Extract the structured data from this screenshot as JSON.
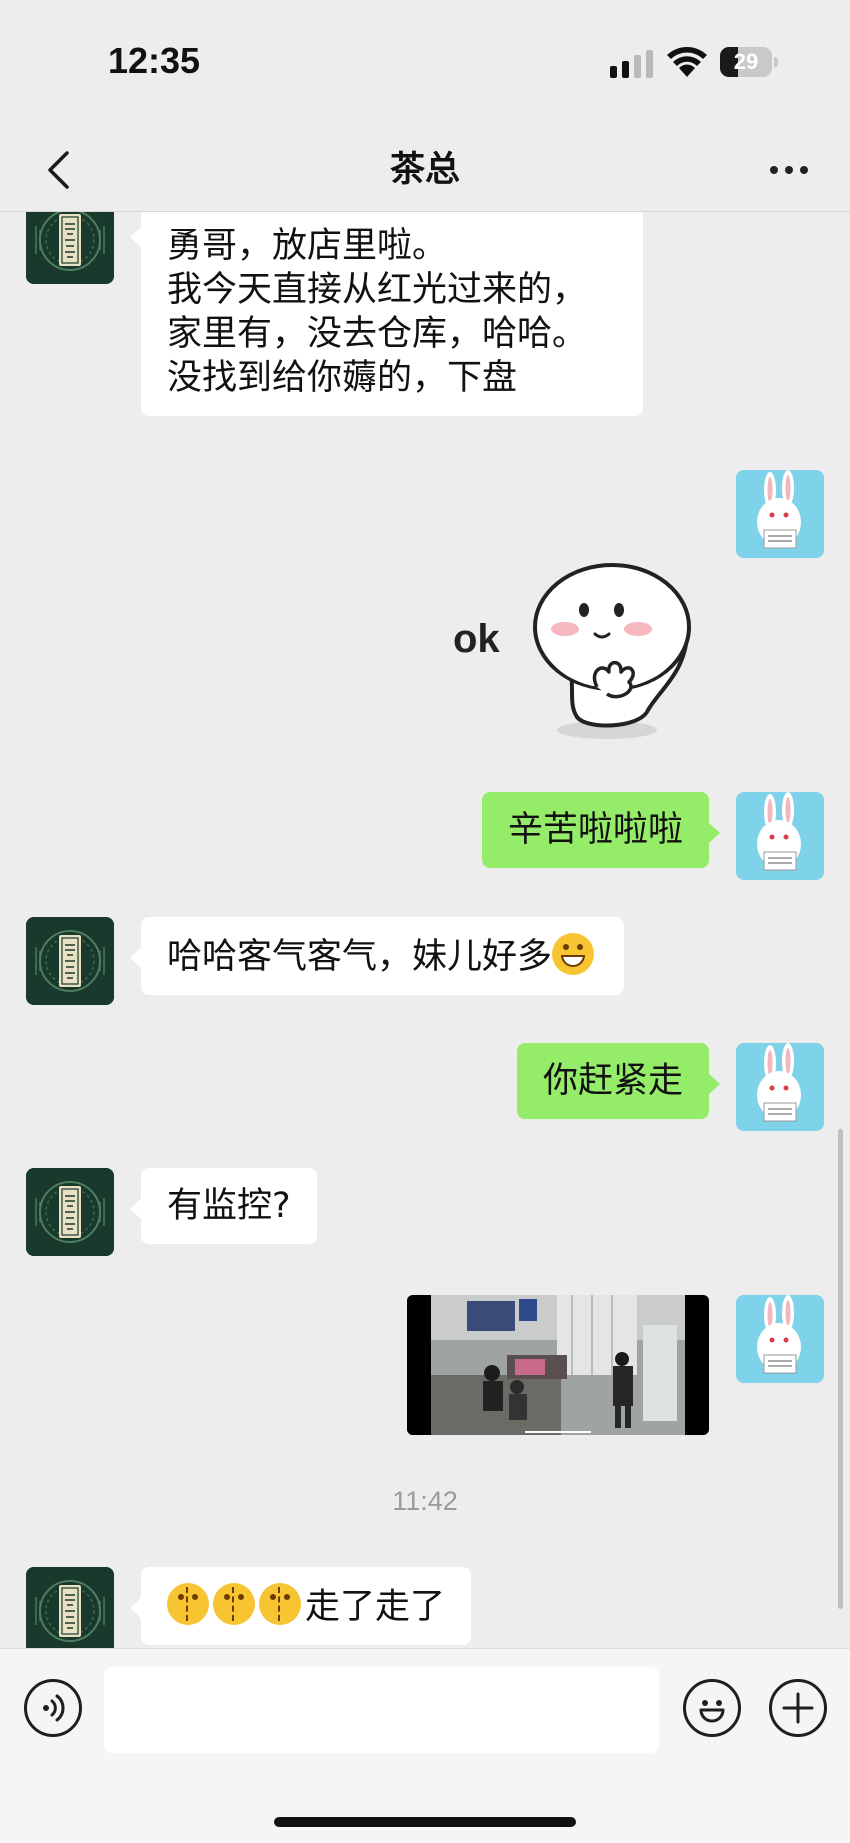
{
  "status_bar": {
    "time": "12:35",
    "battery_level": "29",
    "signal_icon": "cellular-signal-icon",
    "wifi_icon": "wifi-icon",
    "battery_icon": "battery-icon"
  },
  "nav": {
    "title": "茶总",
    "back_icon": "chevron-left-icon",
    "more_icon": "more-dots-icon"
  },
  "messages": [
    {
      "sender": "contact",
      "type": "text",
      "lines": [
        "勇哥，放店里啦。",
        "我今天直接从红光过来的，",
        "家里有，没去仓库，哈哈。",
        "没找到给你薅的，下盘"
      ]
    },
    {
      "sender": "me",
      "type": "sticker",
      "sticker_text": "ok"
    },
    {
      "sender": "me",
      "type": "text",
      "text": "辛苦啦啦啦"
    },
    {
      "sender": "contact",
      "type": "text",
      "text": "哈哈客气客气，妹儿好多",
      "emoji": "grin-emoji"
    },
    {
      "sender": "me",
      "type": "text",
      "text": "你赶紧走"
    },
    {
      "sender": "contact",
      "type": "text",
      "text": "有监控?"
    },
    {
      "sender": "me",
      "type": "video",
      "thumbnail": "surveillance-video-thumbnail"
    },
    {
      "type": "timestamp",
      "text": "11:42"
    },
    {
      "sender": "contact",
      "type": "text",
      "text": "走了走了",
      "emoji": "crying-laughing-emoji",
      "emoji_count": 3
    }
  ],
  "input_bar": {
    "voice_icon": "voice-icon",
    "emoji_icon": "smiley-icon",
    "plus_icon": "plus-icon",
    "input_value": ""
  },
  "colors": {
    "background": "#ededed",
    "outgoing_bubble": "#95ec69",
    "incoming_bubble": "#ffffff",
    "shop_avatar": "#18392c",
    "rabbit_avatar_bg": "#7ed3eb"
  }
}
